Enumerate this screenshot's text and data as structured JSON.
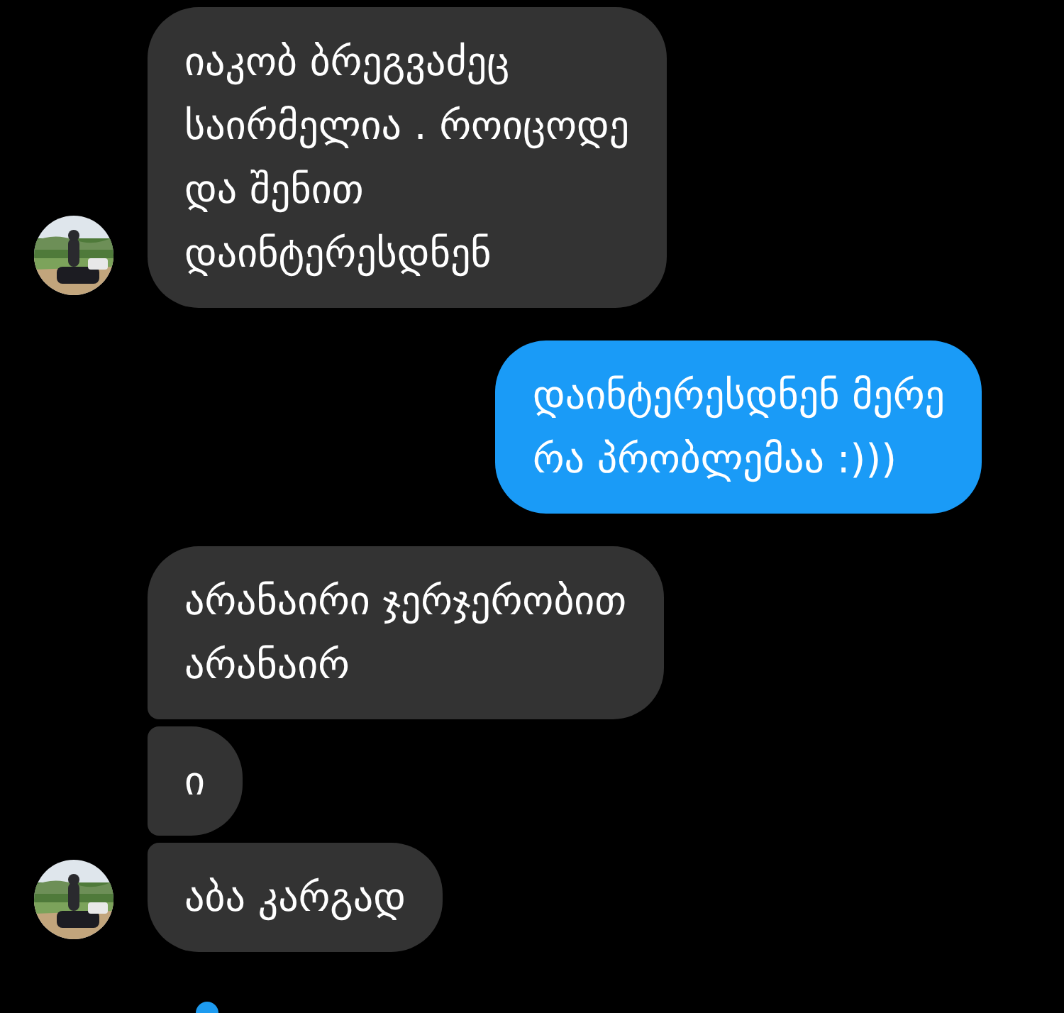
{
  "messages": [
    {
      "kind": "incoming",
      "text": "იაკობ ბრეგვაძეც\nსაირმელია . როიცოდე\nდა შენით\nდაინტერესდნენ"
    },
    {
      "kind": "outgoing",
      "text": "დაინტერესდნენ მერე\nრა პრობლემაა :)))"
    },
    {
      "kind": "incoming",
      "text": "არანაირი ჯერჯერობით\nარანაირ"
    },
    {
      "kind": "incoming",
      "text": "ი"
    },
    {
      "kind": "incoming",
      "text": "აბა კარგად"
    }
  ]
}
